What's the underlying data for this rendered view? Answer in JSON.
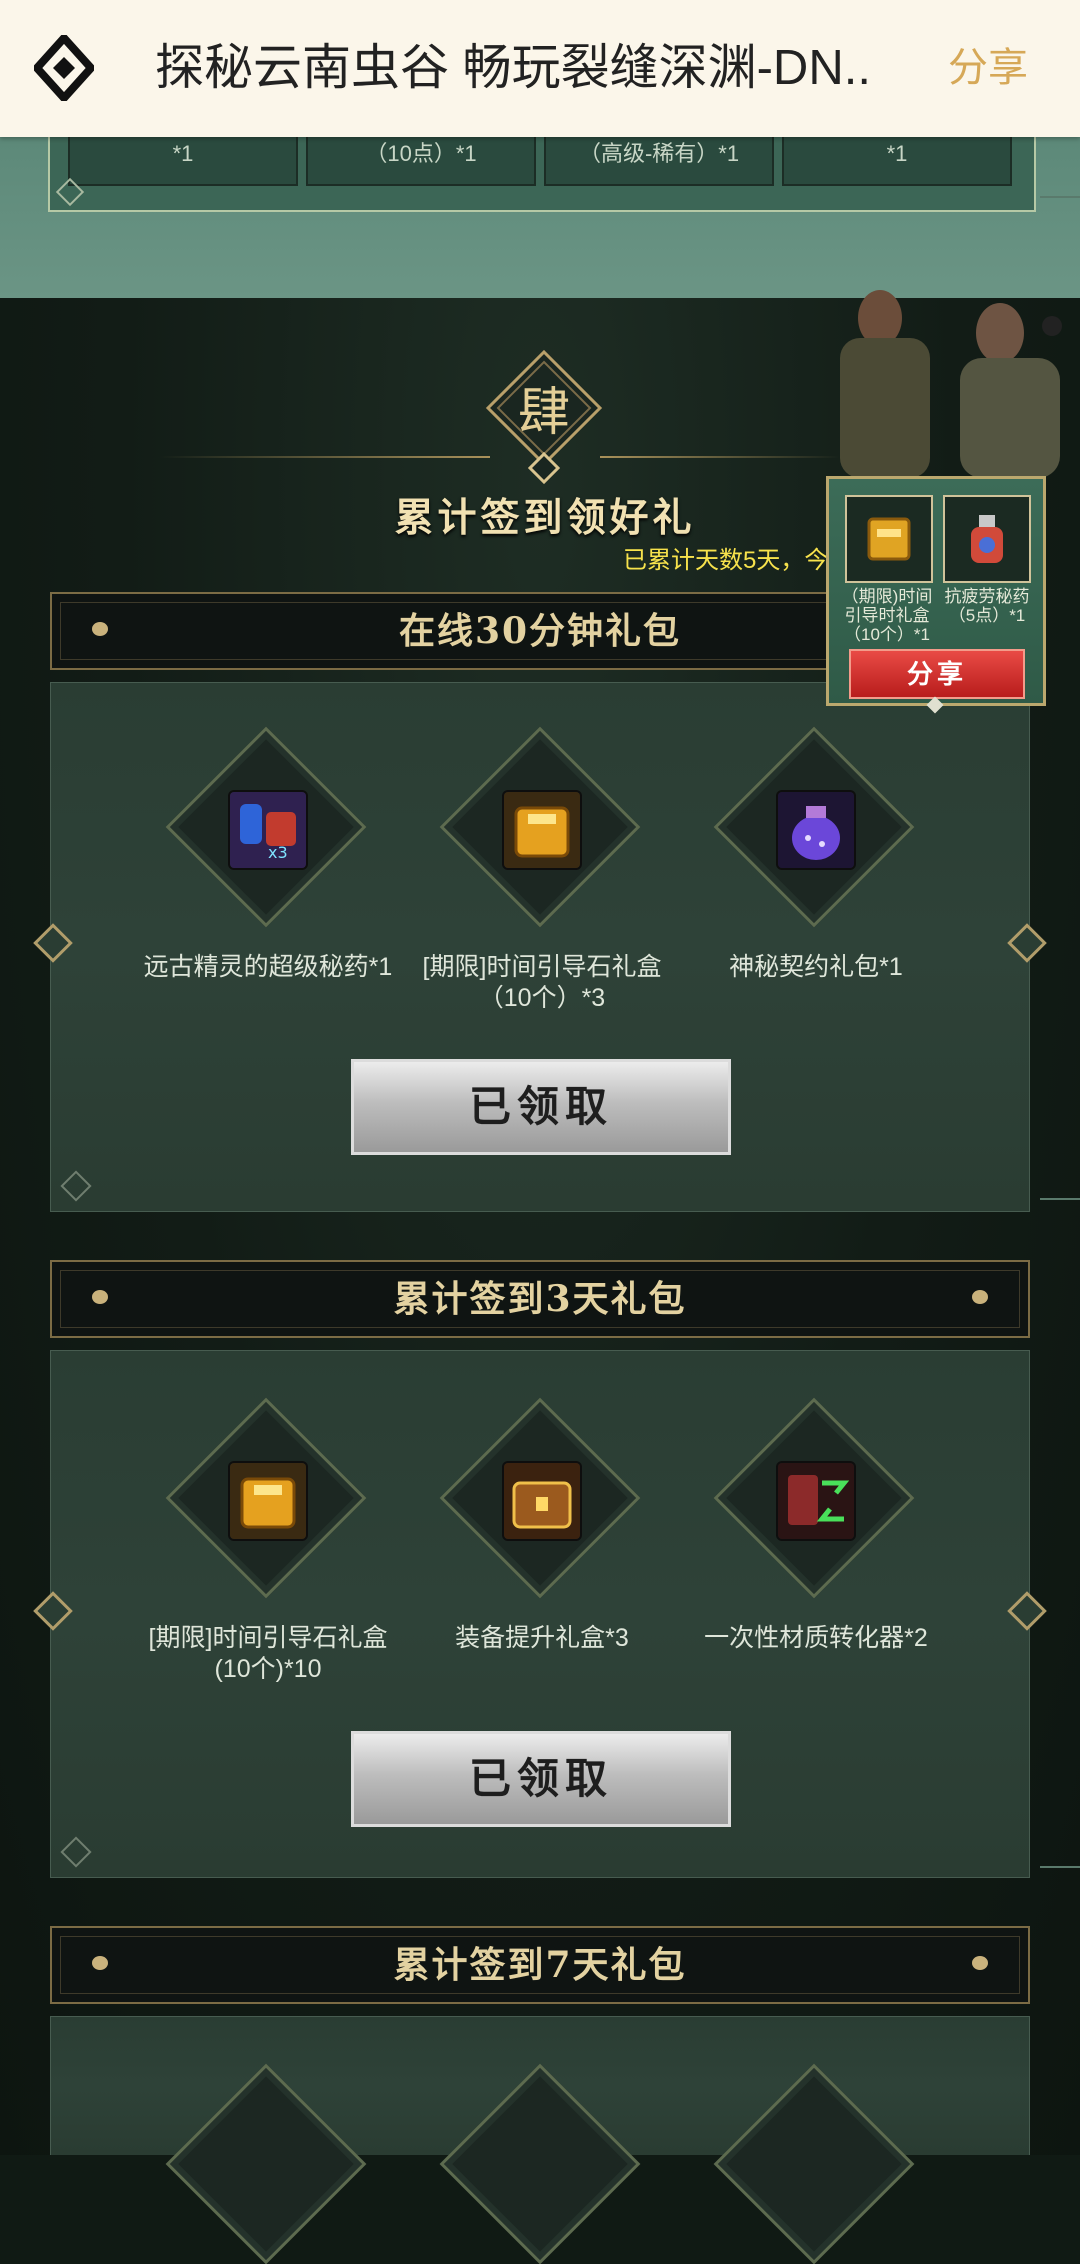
{
  "header": {
    "title": "探秘云南虫谷 畅玩裂缝深渊-DN..",
    "share_label": "分享"
  },
  "top_rewards": [
    {
      "text": "*1"
    },
    {
      "text": "（10点）*1"
    },
    {
      "text": "（高级-稀有）*1"
    },
    {
      "text": "*1"
    }
  ],
  "section": {
    "emblem_char": "肆",
    "title": "累计签到领好礼",
    "subtitle": "已累计天数5天，今"
  },
  "popup": {
    "items": [
      {
        "name": "（期限)时间引导时礼盒（10个）*1",
        "icon": "gold-box-icon"
      },
      {
        "name": "抗疲劳秘药（5点）*1",
        "icon": "potion-icon"
      }
    ],
    "share_label": "分享"
  },
  "packages": [
    {
      "title": "在线30分钟礼包",
      "button_label": "已领取",
      "items": [
        {
          "name": "远古精灵的超级秘药*1",
          "icon": "exp-potion-icon"
        },
        {
          "name": "[期限]时间引导石礼盒（10个）*3",
          "icon": "gold-box-icon"
        },
        {
          "name": "神秘契约礼包*1",
          "icon": "purple-bag-icon"
        }
      ]
    },
    {
      "title": "累计签到3天礼包",
      "button_label": "已领取",
      "items": [
        {
          "name": "[期限]时间引导石礼盒 (10个)*10",
          "icon": "gold-box-icon"
        },
        {
          "name": "装备提升礼盒*3",
          "icon": "treasure-chest-icon"
        },
        {
          "name": "一次性材质转化器*2",
          "icon": "converter-icon"
        }
      ]
    },
    {
      "title": "累计签到7天礼包",
      "button_label": "",
      "items": []
    }
  ],
  "colors": {
    "header_bg": "#fbf6ea",
    "share_gold": "#d6a857",
    "subtitle_yellow": "#f7e24c",
    "popup_button_red": "#d93330"
  }
}
